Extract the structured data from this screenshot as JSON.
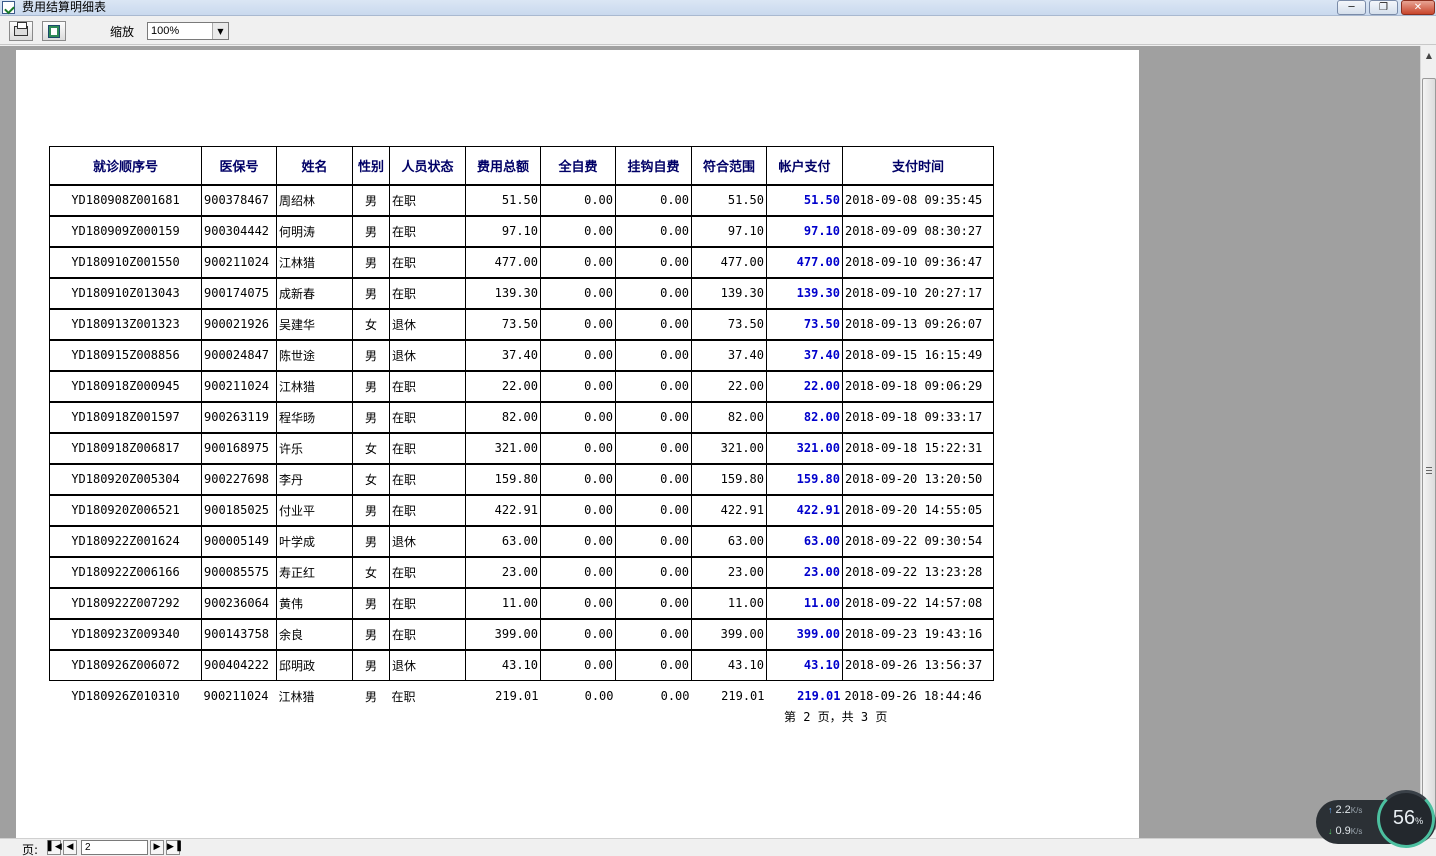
{
  "window": {
    "title": "费用结算明细表"
  },
  "toolbar": {
    "zoom_label": "缩放",
    "zoom_value": "100%"
  },
  "table": {
    "headers": [
      "就诊顺序号",
      "医保号",
      "姓名",
      "性别",
      "人员状态",
      "费用总额",
      "全自费",
      "挂钩自费",
      "符合范围",
      "帐户支付",
      "支付时间"
    ],
    "rows": [
      [
        "YD180908Z001681",
        "900378467",
        "周绍林",
        "男",
        "在职",
        "51.50",
        "0.00",
        "0.00",
        "51.50",
        "51.50",
        "2018-09-08 09:35:45"
      ],
      [
        "YD180909Z000159",
        "900304442",
        "何明涛",
        "男",
        "在职",
        "97.10",
        "0.00",
        "0.00",
        "97.10",
        "97.10",
        "2018-09-09 08:30:27"
      ],
      [
        "YD180910Z001550",
        "900211024",
        "江林猎",
        "男",
        "在职",
        "477.00",
        "0.00",
        "0.00",
        "477.00",
        "477.00",
        "2018-09-10 09:36:47"
      ],
      [
        "YD180910Z013043",
        "900174075",
        "成新春",
        "男",
        "在职",
        "139.30",
        "0.00",
        "0.00",
        "139.30",
        "139.30",
        "2018-09-10 20:27:17"
      ],
      [
        "YD180913Z001323",
        "900021926",
        "吴建华",
        "女",
        "退休",
        "73.50",
        "0.00",
        "0.00",
        "73.50",
        "73.50",
        "2018-09-13 09:26:07"
      ],
      [
        "YD180915Z008856",
        "900024847",
        "陈世途",
        "男",
        "退休",
        "37.40",
        "0.00",
        "0.00",
        "37.40",
        "37.40",
        "2018-09-15 16:15:49"
      ],
      [
        "YD180918Z000945",
        "900211024",
        "江林猎",
        "男",
        "在职",
        "22.00",
        "0.00",
        "0.00",
        "22.00",
        "22.00",
        "2018-09-18 09:06:29"
      ],
      [
        "YD180918Z001597",
        "900263119",
        "程华旸",
        "男",
        "在职",
        "82.00",
        "0.00",
        "0.00",
        "82.00",
        "82.00",
        "2018-09-18 09:33:17"
      ],
      [
        "YD180918Z006817",
        "900168975",
        "许乐",
        "女",
        "在职",
        "321.00",
        "0.00",
        "0.00",
        "321.00",
        "321.00",
        "2018-09-18 15:22:31"
      ],
      [
        "YD180920Z005304",
        "900227698",
        "李丹",
        "女",
        "在职",
        "159.80",
        "0.00",
        "0.00",
        "159.80",
        "159.80",
        "2018-09-20 13:20:50"
      ],
      [
        "YD180920Z006521",
        "900185025",
        "付业平",
        "男",
        "在职",
        "422.91",
        "0.00",
        "0.00",
        "422.91",
        "422.91",
        "2018-09-20 14:55:05"
      ],
      [
        "YD180922Z001624",
        "900005149",
        "叶学成",
        "男",
        "退休",
        "63.00",
        "0.00",
        "0.00",
        "63.00",
        "63.00",
        "2018-09-22 09:30:54"
      ],
      [
        "YD180922Z006166",
        "900085575",
        "寿正红",
        "女",
        "在职",
        "23.00",
        "0.00",
        "0.00",
        "23.00",
        "23.00",
        "2018-09-22 13:23:28"
      ],
      [
        "YD180922Z007292",
        "900236064",
        "黄伟",
        "男",
        "在职",
        "11.00",
        "0.00",
        "0.00",
        "11.00",
        "11.00",
        "2018-09-22 14:57:08"
      ],
      [
        "YD180923Z009340",
        "900143758",
        "余良",
        "男",
        "在职",
        "399.00",
        "0.00",
        "0.00",
        "399.00",
        "399.00",
        "2018-09-23 19:43:16"
      ],
      [
        "YD180926Z006072",
        "900404222",
        "邱明政",
        "男",
        "退休",
        "43.10",
        "0.00",
        "0.00",
        "43.10",
        "43.10",
        "2018-09-26 13:56:37"
      ],
      [
        "YD180926Z010310",
        "900211024",
        "江林猎",
        "男",
        "在职",
        "219.01",
        "0.00",
        "0.00",
        "219.01",
        "219.01",
        "2018-09-26 18:44:46"
      ]
    ]
  },
  "footer": {
    "page_text": "第 2 页，共 3 页"
  },
  "pager": {
    "label": "页:",
    "current_page": "2"
  },
  "netspeed": {
    "upload": "2.2",
    "download": "0.9",
    "unit": "K/s",
    "percent": "56",
    "percent_sign": "%"
  }
}
